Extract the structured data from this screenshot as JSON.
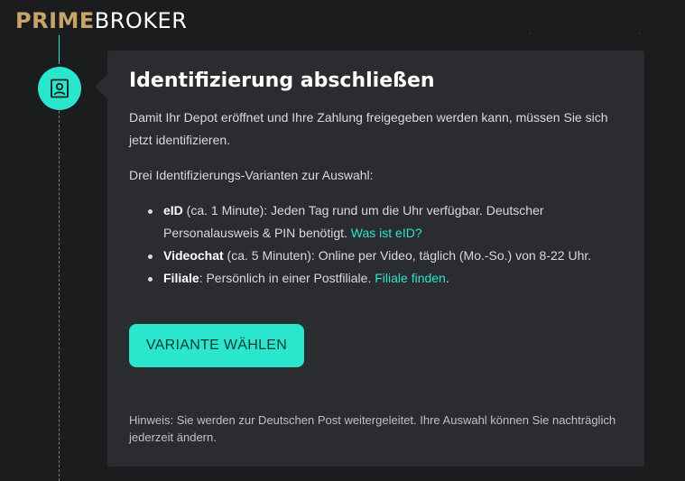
{
  "brand": {
    "prime": "PRIME",
    "broker": "BROKER"
  },
  "timeline": {
    "step_icon": "id-card-icon",
    "accent_color": "#29e6cd"
  },
  "card": {
    "title": "Identifizierung abschließen",
    "intro": "Damit Ihr Depot eröffnet und Ihre Zahlung freigegeben werden kann, müssen Sie sich jetzt identifizieren.",
    "variants_label": "Drei Identifizierungs-Varianten zur Auswahl:",
    "variants": [
      {
        "name": "eID",
        "details": " (ca. 1 Minute): Jeden Tag rund um die Uhr verfügbar. Deutscher Personalausweis & PIN benötigt. ",
        "link": "Was ist eID?"
      },
      {
        "name": "Videochat",
        "details": " (ca. 5 Minuten): Online per Video, täglich (Mo.-So.) von 8-22 Uhr."
      },
      {
        "name": "Filiale",
        "details": ": Persönlich in einer Postfiliale. ",
        "link": "Filiale finden",
        "suffix": "."
      }
    ],
    "cta_label": "VARIANTE WÄHLEN",
    "hint": "Hinweis: Sie werden zur Deutschen Post weitergeleitet. Ihre Auswahl können Sie nachträglich jederzeit ändern."
  }
}
